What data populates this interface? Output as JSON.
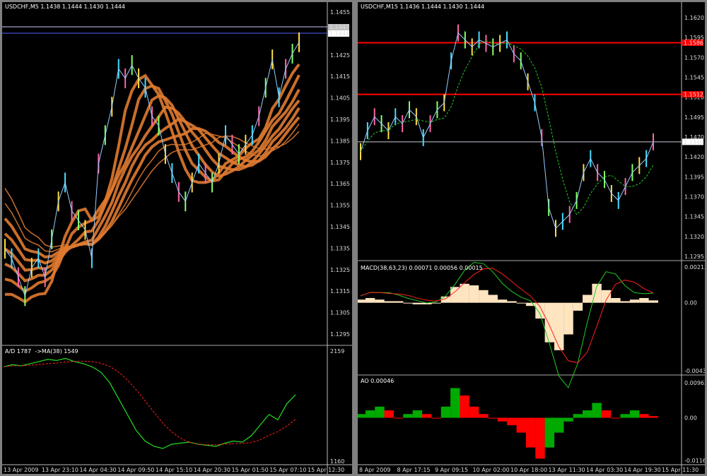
{
  "windows": [
    {
      "id": "left",
      "header": "USDCHF,M5",
      "ohlc": "1.1438 1.1444 1.1430 1.1444",
      "price_axis": [
        "1.1455",
        "1.1435",
        "1.1425",
        "1.1415",
        "1.1405",
        "1.1395",
        "1.1385",
        "1.1375",
        "1.1365",
        "1.1355",
        "1.1345",
        "1.1335",
        "1.1325",
        "1.1315",
        "1.1305",
        "1.1295"
      ],
      "badges": [
        {
          "value": "1.1447",
          "bg": "#c0c0c0",
          "fg": "#000"
        },
        {
          "value": "1.1444",
          "bg": "#ffffff",
          "fg": "#000"
        }
      ],
      "indicator": {
        "name": "A/D 1787",
        "ma": "->MA(38) 1549",
        "top": "2159",
        "bottom": "1160"
      },
      "time_axis": [
        "13 Apr 2009",
        "13 Apr 23:10",
        "14 Apr 04:30",
        "14 Apr 09:50",
        "14 Apr 15:10",
        "14 Apr 20:30",
        "15 Apr 01:50",
        "15 Apr 07:10",
        "15 Apr 12:30"
      ]
    },
    {
      "id": "right",
      "header": "USDCHF,M15",
      "ohlc": "1.1436 1.1444 1.1430 1.1444",
      "price_axis": [
        "1.1620",
        "1.1595",
        "1.1570",
        "1.1545",
        "1.1520",
        "1.1495",
        "1.1470",
        "1.1420",
        "1.1395",
        "1.1370",
        "1.1345",
        "1.1320",
        "1.1295"
      ],
      "badges": [
        {
          "value": "1.1586",
          "bg": "#ff0000",
          "fg": "#000"
        },
        {
          "value": "1.1512",
          "bg": "#ff0000",
          "fg": "#000"
        },
        {
          "value": "1.1444",
          "bg": "#ffffff",
          "fg": "#000"
        }
      ],
      "macd": {
        "label": "MACD(38,63,23) 0.00071 0.00056 0.00015",
        "top": "0.00213",
        "mid": "0.00",
        "bottom": "-0.0043"
      },
      "ao": {
        "label": "AO 0.00046",
        "top": "0.00962",
        "mid": "0.00",
        "bottom": "-0.01169"
      },
      "time_axis": [
        "8 Apr 2009",
        "8 Apr 17:15",
        "9 Apr 09:15",
        "10 Apr 02:00",
        "10 Apr 18:00",
        "13 Apr 11:30",
        "14 Apr 03:30",
        "14 Apr 19:30",
        "15 Apr 11:30"
      ]
    }
  ],
  "colors": {
    "bg": "#000000",
    "ribbon": "#e07a30",
    "ad": "#22dd22",
    "ma": "#ff2020",
    "macd_hist": "#ffe4c0",
    "ao_up": "#00aa00",
    "ao_down": "#ff0000",
    "hline_red": "#ff0000",
    "hline_white": "#c8c8ff"
  },
  "chart_data": [
    {
      "type": "line",
      "title": "USDCHF,M5",
      "ylim": [
        1.129,
        1.146
      ],
      "series": [
        {
          "values": [
            1.1335,
            1.133,
            1.132,
            1.131,
            1.1325,
            1.133,
            1.132,
            1.134,
            1.136,
            1.137,
            1.1355,
            1.135,
            1.1345,
            1.133,
            1.138,
            1.1395,
            1.141,
            1.143,
            1.1425,
            1.1432,
            1.1425,
            1.142,
            1.1405,
            1.14,
            1.1385,
            1.1375,
            1.1365,
            1.136,
            1.137,
            1.138,
            1.1375,
            1.137,
            1.138,
            1.1395,
            1.139,
            1.1385,
            1.139,
            1.1395,
            1.1405,
            1.142,
            1.1435,
            1.1415,
            1.143,
            1.1438,
            1.1444
          ]
        }
      ]
    },
    {
      "type": "line",
      "title": "A/D 1787",
      "ylim": [
        1160,
        2159
      ],
      "series": [
        {
          "values": [
            2050,
            2070,
            2060,
            2080,
            2100,
            2120,
            2110,
            2130,
            2100,
            2080,
            2050,
            2000,
            1900,
            1750,
            1600,
            1450,
            1350,
            1300,
            1280,
            1320,
            1330,
            1340,
            1320,
            1310,
            1300,
            1330,
            1350,
            1340,
            1400,
            1500,
            1600,
            1550,
            1700,
            1787
          ]
        }
      ]
    },
    {
      "type": "line",
      "title": "USDCHF,M15",
      "ylim": [
        1.1285,
        1.163
      ],
      "series": [
        {
          "values": [
            1.143,
            1.146,
            1.148,
            1.147,
            1.146,
            1.148,
            1.147,
            1.149,
            1.148,
            1.145,
            1.147,
            1.149,
            1.15,
            1.156,
            1.16,
            1.159,
            1.158,
            1.159,
            1.1585,
            1.158,
            1.1585,
            1.159,
            1.157,
            1.156,
            1.153,
            1.15,
            1.145,
            1.135,
            1.132,
            1.133,
            1.134,
            1.136,
            1.14,
            1.142,
            1.14,
            1.139,
            1.137,
            1.136,
            1.138,
            1.14,
            1.141,
            1.142,
            1.1444
          ]
        }
      ]
    },
    {
      "type": "bar",
      "title": "MACD(38,63,23)",
      "ylim": [
        -0.0043,
        0.00213
      ],
      "series": [
        {
          "values": [
            0.0002,
            0.0003,
            0.0002,
            0.0001,
            0.0001,
            0.0,
            -0.0001,
            -0.0001,
            0.0,
            0.0004,
            0.001,
            0.0012,
            0.0011,
            0.0008,
            0.0005,
            0.0002,
            0.0001,
            0.0,
            -0.0002,
            -0.001,
            -0.0025,
            -0.003,
            -0.002,
            -0.0005,
            0.0005,
            0.0012,
            0.0008,
            0.0003,
            0.0001,
            0.0002,
            0.0003,
            0.00015
          ]
        }
      ]
    },
    {
      "type": "bar",
      "title": "AO 0.00046",
      "ylim": [
        -0.01169,
        0.00962
      ],
      "series": [
        {
          "values": [
            0.001,
            0.002,
            0.003,
            0.002,
            0.0,
            0.001,
            0.002,
            0.001,
            0.0,
            0.003,
            0.008,
            0.006,
            0.003,
            0.001,
            0.0,
            -0.001,
            -0.002,
            -0.004,
            -0.008,
            -0.011,
            -0.008,
            -0.004,
            -0.001,
            0.001,
            0.002,
            0.004,
            0.002,
            0.0,
            0.001,
            0.002,
            0.001,
            0.00046
          ]
        }
      ]
    }
  ]
}
